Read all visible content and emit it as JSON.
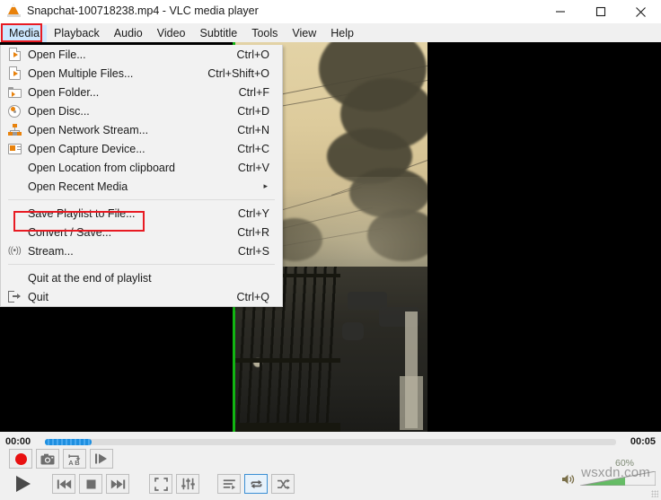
{
  "window": {
    "title": "Snapchat-100718238.mp4 - VLC media player",
    "app_icon": "vlc-cone-icon",
    "minimize_label": "–",
    "maximize_label": "□",
    "close_label": "×"
  },
  "menubar": {
    "items": [
      {
        "label": "Media",
        "active": true
      },
      {
        "label": "Playback",
        "active": false
      },
      {
        "label": "Audio",
        "active": false
      },
      {
        "label": "Video",
        "active": false
      },
      {
        "label": "Subtitle",
        "active": false
      },
      {
        "label": "Tools",
        "active": false
      },
      {
        "label": "View",
        "active": false
      },
      {
        "label": "Help",
        "active": false
      }
    ]
  },
  "media_menu": {
    "items": [
      {
        "label": "Open File...",
        "accel": "Ctrl+O",
        "icon": "file-play-icon"
      },
      {
        "label": "Open Multiple Files...",
        "accel": "Ctrl+Shift+O",
        "icon": "file-play-icon"
      },
      {
        "label": "Open Folder...",
        "accel": "Ctrl+F",
        "icon": "folder-play-icon"
      },
      {
        "label": "Open Disc...",
        "accel": "Ctrl+D",
        "icon": "disc-icon"
      },
      {
        "label": "Open Network Stream...",
        "accel": "Ctrl+N",
        "icon": "network-icon"
      },
      {
        "label": "Open Capture Device...",
        "accel": "Ctrl+C",
        "icon": "capture-device-icon"
      },
      {
        "label": "Open Location from clipboard",
        "accel": "Ctrl+V",
        "icon": "none"
      },
      {
        "label": "Open Recent Media",
        "accel": "",
        "icon": "none",
        "submenu": true
      },
      {
        "label": "Save Playlist to File...",
        "accel": "Ctrl+Y",
        "icon": "none",
        "highlighted": true
      },
      {
        "label": "Convert / Save...",
        "accel": "Ctrl+R",
        "icon": "none"
      },
      {
        "label": "Stream...",
        "accel": "Ctrl+S",
        "icon": "stream-icon"
      },
      {
        "label": "Quit at the end of playlist",
        "accel": "",
        "icon": "none"
      },
      {
        "label": "Quit",
        "accel": "Ctrl+Q",
        "icon": "quit-icon"
      }
    ],
    "submenu_arrow": "▸"
  },
  "annotations": {
    "highlight_color": "#e81b23",
    "boxes": [
      "media-menu-button",
      "save-playlist-to-file-item"
    ]
  },
  "playback": {
    "elapsed": "00:00",
    "total": "00:05",
    "progress_percent": 8
  },
  "controls": {
    "record_label": "Record",
    "snapshot_label": "Take Snapshot",
    "ab_loop_label": "A B",
    "frame_label": "Frame by frame",
    "play_label": "Play",
    "previous_label": "Previous",
    "stop_label": "Stop",
    "next_label": "Next",
    "fullscreen_label": "Toggle fullscreen",
    "extended_label": "Extended settings",
    "playlist_label": "Show playlist",
    "loop_label": "Loop",
    "loop_active": true,
    "shuffle_label": "Random",
    "volume_percent": "60%",
    "volume_value": 60
  },
  "watermark": {
    "text": "wsxdn.com"
  },
  "colors": {
    "accent_blue": "#1e8fe0",
    "volume_green": "#5db85d",
    "record_red": "#e81010",
    "menu_highlight": "#cde8ff",
    "annotation_red": "#e81b23"
  }
}
